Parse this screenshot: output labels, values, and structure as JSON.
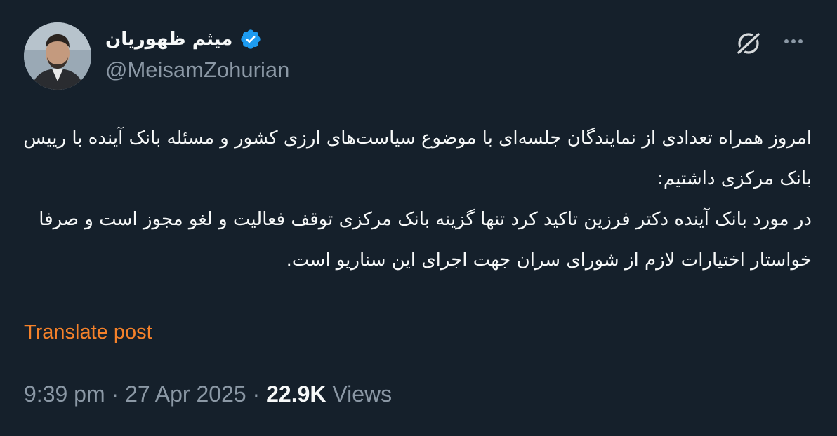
{
  "author": {
    "display_name": "میثم ظهوریان",
    "handle": "@MeisamZohurian",
    "verified": true,
    "verified_color": "#1d9bf0"
  },
  "header_icons": {
    "grok": "grok-icon",
    "more": "more-icon"
  },
  "post": {
    "text_lines": [
      "امروز همراه تعدادی از نمایندگان جلسه‌ای با موضوع سیاست‌های ارزی کشور و مسئله بانک آینده با رییس بانک مرکزی داشتیم:",
      "در مورد بانک آینده دکتر فرزین تاکید کرد تنها گزینه بانک مرکزی توقف فعالیت و لغو مجوز است و صرفا خواستار اختیارات لازم از شورای سران جهت اجرای این سناریو است."
    ],
    "translate_label": "Translate post",
    "translate_color": "#f4812a"
  },
  "meta": {
    "time": "9:39 pm",
    "separator": "·",
    "date": "27 Apr 2025",
    "views_count": "22.9K",
    "views_label": "Views"
  },
  "colors": {
    "background": "#15202b",
    "text_primary": "#f7f9f9",
    "text_secondary": "#8b98a5"
  }
}
